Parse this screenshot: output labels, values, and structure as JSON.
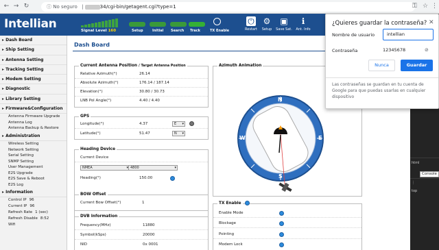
{
  "browser": {
    "security_text": "No seguro",
    "url_suffix": "34/cgi-bin/getagent.cgi?type=1"
  },
  "header": {
    "logo": "Intellian",
    "signal_label": "Signal Level",
    "signal_value": "160",
    "status_items": [
      "Setup",
      "Initial",
      "Search",
      "Track"
    ],
    "tx_label": "TX Enable",
    "toolbar": [
      {
        "label": "Restart",
        "icon": "power-icon"
      },
      {
        "label": "Setup",
        "icon": "gear-icon"
      },
      {
        "label": "Save Sat.",
        "icon": "floppy-icon"
      },
      {
        "label": "Ant. Info",
        "icon": "info-icon"
      }
    ]
  },
  "sidebar": {
    "menus": [
      "Dash Board",
      "Ship Setting",
      "Antenna Setting",
      "Tracking Setting",
      "Modem Setting",
      "Diagnostic",
      "Library Setting",
      "Firmware&Configuration"
    ],
    "firmware_items": [
      "Antenna Firmware Upgrade",
      "Antenna Log",
      "Antenna Backup & Restore"
    ],
    "admin_label": "Administration",
    "admin_items": [
      "Wireless Setting",
      "Network Setting",
      "Serial Setting",
      "SNMP Setting",
      "User Management",
      "E2S Upgrade",
      "E2S Save & Reboot",
      "E2S Log"
    ],
    "info_label": "Information",
    "info_rows": [
      {
        "k": "Control IP",
        "v": "96"
      },
      {
        "k": "Current IP",
        "v": "96"
      },
      {
        "k": "Refresh Rate",
        "v": "1 (sec)"
      },
      {
        "k": "Refresh Disable",
        "v": "8:52"
      },
      {
        "k": "Wifi",
        "v": ""
      }
    ]
  },
  "main": {
    "title": "Dash Board",
    "position_panel": {
      "title": "Current Antenna Position",
      "subtitle": "/ Target Antenna Position",
      "rows": [
        {
          "k": "Relative Azimuth(°)",
          "v": "26.14"
        },
        {
          "k": "Absolute Azimuth(°)",
          "v": "176.14 / 187.14"
        },
        {
          "k": "Elevation(°)",
          "v": "30.80 / 30.73"
        },
        {
          "k": "LNB Pol Angle(°)",
          "v": "4.40 / 4.40"
        }
      ]
    },
    "gps_panel": {
      "title": "GPS",
      "rows": [
        {
          "k": "Longitude(°)",
          "v": "4.37",
          "dir": "E"
        },
        {
          "k": "Latitude(°)",
          "v": "51.47",
          "dir": "N"
        }
      ]
    },
    "heading_panel": {
      "title": "Heading Device",
      "device_label": "Current Device",
      "device_value": "NMEA",
      "baud_value": "4800",
      "heading_label": "Heading(°)",
      "heading_value": "150.00"
    },
    "bow_panel": {
      "title": "BOW Offset",
      "label": "Current Bow Offset(°)",
      "value": "1"
    },
    "dvb_panel": {
      "title": "DVB Information",
      "rows": [
        {
          "k": "Frequency(MHz)",
          "v": "11880"
        },
        {
          "k": "Symbol(kSps)",
          "v": "20000"
        },
        {
          "k": "NID",
          "v": "0x 0001"
        }
      ]
    },
    "azimuth_panel": {
      "title": "Azimuth Animation",
      "compass": {
        "n": "N",
        "e": "E",
        "s": "S",
        "w": "W"
      }
    },
    "tx_panel": {
      "title": "TX Enable",
      "rows": [
        "Enable Mode",
        "Blockage",
        "Pointing",
        "Modem Lock"
      ]
    }
  },
  "devtools": {
    "html": "html",
    "console_tip": "Console",
    "top": "top"
  },
  "popup": {
    "title": "¿Quieres guardar la contraseña?",
    "user_label": "Nombre de usuario",
    "user_value": "intellian",
    "pass_label": "Contraseña",
    "pass_value": "12345678",
    "btn_never": "Nunca",
    "btn_save": "Guardar",
    "footer": "Las contraseñas se guardan en tu cuenta de Google para que puedas usarlas en cualquier dispositivo"
  },
  "colors": {
    "header_blue": "#1d4f8f",
    "status_green": "#3a9a3a",
    "google_blue": "#1a73e8",
    "led_blue": "#2d8bdc"
  }
}
